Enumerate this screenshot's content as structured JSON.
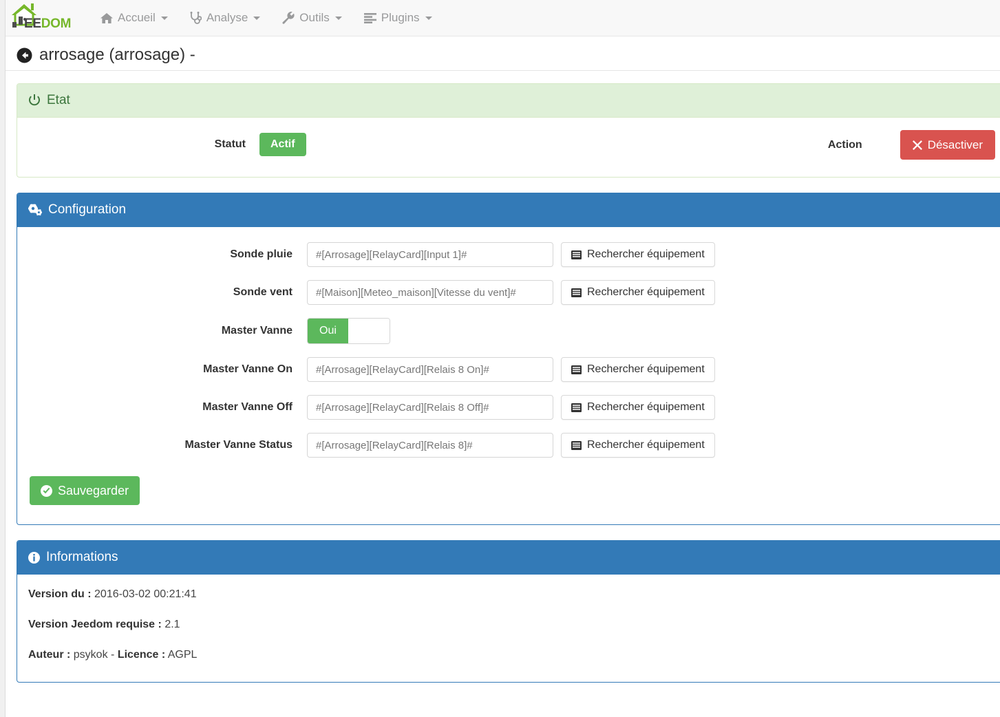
{
  "brand": {
    "text_dark": "EE",
    "text_green": "DOM",
    "icon": "house-logo-icon"
  },
  "nav": {
    "items": [
      {
        "label": "Accueil",
        "icon": "home-icon"
      },
      {
        "label": "Analyse",
        "icon": "stethoscope-icon"
      },
      {
        "label": "Outils",
        "icon": "wrench-icon"
      },
      {
        "label": "Plugins",
        "icon": "list-icon"
      }
    ]
  },
  "header": {
    "title": "arrosage (arrosage) -",
    "back_icon": "arrow-circle-left-icon"
  },
  "etat": {
    "panel_title": "Etat",
    "panel_icon": "power-off-icon",
    "statut_label": "Statut",
    "statut_value": "Actif",
    "action_label": "Action",
    "action_button": "Désactiver",
    "action_button_icon": "times-icon"
  },
  "configuration": {
    "panel_title": "Configuration",
    "panel_icon": "cogs-icon",
    "search_button_label": "Rechercher équipement",
    "search_button_icon": "list-alt-icon",
    "fields": [
      {
        "label": "Sonde pluie",
        "value": "#[Arrosage][RelayCard][Input 1]#",
        "type": "text"
      },
      {
        "label": "Sonde vent",
        "value": "#[Maison][Meteo_maison][Vitesse du vent]#",
        "type": "text"
      },
      {
        "label": "Master Vanne",
        "value": "Oui",
        "type": "switch"
      },
      {
        "label": "Master Vanne On",
        "value": "#[Arrosage][RelayCard][Relais 8 On]#",
        "type": "text"
      },
      {
        "label": "Master Vanne Off",
        "value": "#[Arrosage][RelayCard][Relais 8 Off]#",
        "type": "text"
      },
      {
        "label": "Master Vanne Status",
        "value": "#[Arrosage][RelayCard][Relais 8]#",
        "type": "text"
      }
    ],
    "save_label": "Sauvegarder",
    "save_icon": "check-circle-icon"
  },
  "informations": {
    "panel_title": "Informations",
    "panel_icon": "info-circle-icon",
    "lines": [
      {
        "label": "Version du :",
        "value": "2016-03-02 00:21:41"
      },
      {
        "label": "Version Jeedom requise :",
        "value": "2.1"
      },
      {
        "label": "Auteur :",
        "value": "psykok -",
        "label2": "Licence :",
        "value2": "AGPL"
      }
    ]
  },
  "colors": {
    "brand_green": "#76b72a",
    "primary_blue": "#337ab7",
    "success_green": "#5cb85c",
    "danger_red": "#d9534f",
    "panel_success_bg": "#dff0d8"
  }
}
